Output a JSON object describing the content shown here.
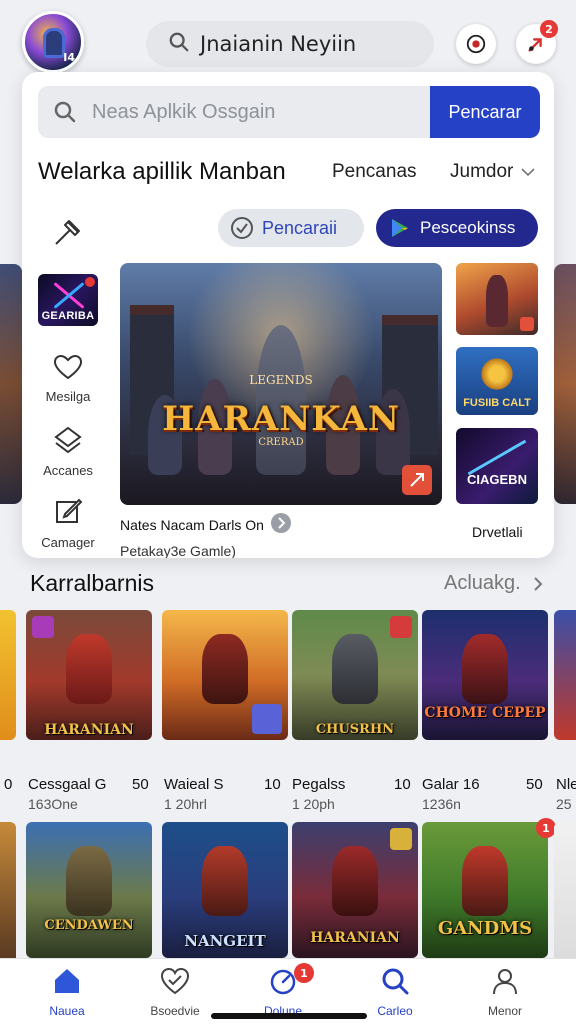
{
  "topbar": {
    "avatar_tag": "I4",
    "search_query": "Jnaianin Neyiin",
    "notification_count": "2"
  },
  "search": {
    "placeholder": "Neas Aplkik Ossgain",
    "button_label": "Pencarar"
  },
  "section_main": {
    "title": "Welarka apillik Manban",
    "sort_label": "Pencanas",
    "filter_label": "Jumdor"
  },
  "chips": {
    "search_chip": "Pencaraii",
    "play_chip": "Pesceokinss"
  },
  "side_nav": {
    "thumb_label": "GEARIBA",
    "items": [
      {
        "label": "Mesilga",
        "icon": "heart-icon"
      },
      {
        "label": "Accanes",
        "icon": "layers-icon"
      },
      {
        "label": "Camager",
        "icon": "edit-icon"
      }
    ]
  },
  "hero": {
    "logo_top": "LEGENDS",
    "logo": "HARANKAN",
    "logo_sub": "CRERAD",
    "caption_line1": "Nates Nacam Darls On",
    "caption_line2": "Petakay3e Gamle)"
  },
  "right_thumbs": [
    {
      "label": ""
    },
    {
      "label": "FUSIIB CALT"
    },
    {
      "label": "CIAGEBN"
    }
  ],
  "right_caption": "Drvetlali",
  "section_recommend": {
    "title": "Karralbarnis",
    "more_label": "Acluakg."
  },
  "row1": [
    {
      "name": "Cessgaal G",
      "count": "50",
      "sub": "163One",
      "logo": "HARANIAN",
      "accent": "#c0392b"
    },
    {
      "name": "Waieal S",
      "count": "10",
      "sub": "1 20hrl",
      "logo": "",
      "accent": "#d8832c"
    },
    {
      "name": "Pegalss",
      "count": "10",
      "sub": "1 20ph",
      "logo": "CHUSRHN",
      "accent": "#596b3a"
    },
    {
      "name": "Galar 16",
      "count": "50",
      "sub": "1236n",
      "logo": "CHOME CEPEP",
      "accent": "#2c3c7e"
    }
  ],
  "row1_edge": {
    "left_count": "0",
    "right_name": "Nle",
    "right_sub": "25"
  },
  "row2": [
    {
      "logo": "CENDAWEN"
    },
    {
      "logo": "NANGEIT"
    },
    {
      "logo": "HARANIAN"
    },
    {
      "logo": "GANDMS",
      "badge": "1"
    }
  ],
  "bottom_nav": [
    {
      "label": "Nauea",
      "icon": "home-icon",
      "active": true
    },
    {
      "label": "Bsoedvie",
      "icon": "heart-check-icon",
      "active": false
    },
    {
      "label": "Dolune",
      "icon": "gauge-icon",
      "active": false,
      "badge": "1"
    },
    {
      "label": "Carleo",
      "icon": "search-icon",
      "active": false
    },
    {
      "label": "Menor",
      "icon": "user-icon",
      "active": false
    }
  ],
  "colors": {
    "accent": "#2541c6",
    "dark_button": "#22288d",
    "badge": "#e53935"
  }
}
